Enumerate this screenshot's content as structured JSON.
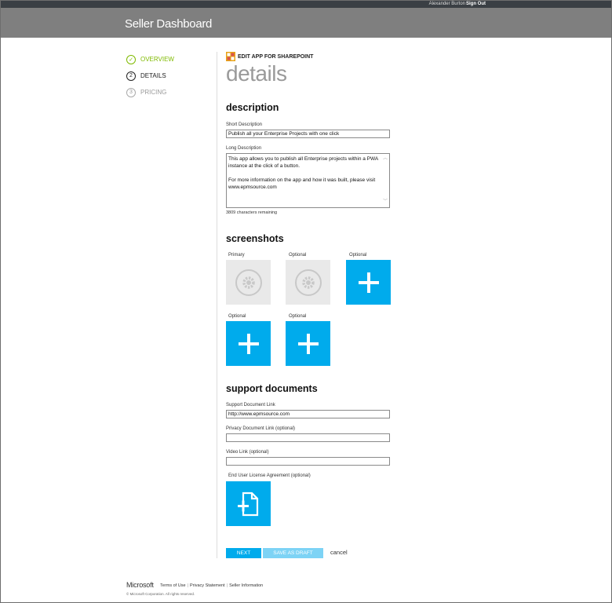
{
  "topbar": {
    "user": "Alexander Burton",
    "sign_out": "Sign Out"
  },
  "header": {
    "title": "Seller Dashboard"
  },
  "steps": [
    {
      "num": "✓",
      "label": "OVERVIEW"
    },
    {
      "num": "2",
      "label": "DETAILS"
    },
    {
      "num": "3",
      "label": "PRICING"
    }
  ],
  "main": {
    "app_heading": "EDIT APP FOR SHAREPOINT",
    "page_title": "details",
    "description": {
      "title": "description",
      "short_label": "Short Description",
      "short_value": "Publish all your Enterprise Projects with one click",
      "long_label": "Long Description",
      "long_para1": "This app allows you to publish all Enterprise projects within a PWA instance at the click of a button.",
      "long_para2": "For more information on the app and how it was built, please visit www.epmsource.com",
      "remaining": "3809 characters remaining"
    },
    "screenshots": {
      "title": "screenshots",
      "labels": [
        "Primary",
        "Optional",
        "Optional",
        "Optional",
        "Optional"
      ]
    },
    "support": {
      "title": "support documents",
      "support_link_label": "Support Document Link",
      "support_link_value": "http://www.epmsource.com",
      "privacy_label": "Privacy Document Link (optional)",
      "privacy_value": "",
      "video_label": "Video Link (optional)",
      "video_value": "",
      "eula_label": "End User License Agreement (optional)"
    },
    "actions": {
      "next": "NEXT",
      "save_draft": "SAVE AS DRAFT",
      "cancel": "cancel"
    }
  },
  "footer": {
    "brand": "Microsoft",
    "terms": "Terms of Use",
    "privacy": "Privacy Statement",
    "seller_info": "Seller Information",
    "separator": "|",
    "copyright": "© Microsoft Corporation. All rights reserved."
  },
  "colors": {
    "accent": "#00abec",
    "done": "#7fba00",
    "header": "#7f7f7f",
    "topbar": "#3a3f44"
  },
  "icons": [
    "gear-icon",
    "plus-icon",
    "add-document-icon",
    "office-app-icon",
    "check-icon"
  ]
}
